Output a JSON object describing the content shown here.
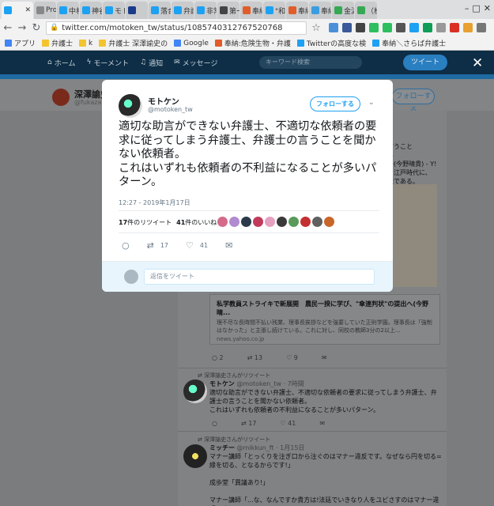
{
  "browser": {
    "tabs": [
      {
        "label": "",
        "color": "#1da1f2"
      },
      {
        "label": "Pro",
        "color": "#888888"
      },
      {
        "label": "中村",
        "color": "#1da1f2"
      },
      {
        "label": "神谷",
        "color": "#1da1f2"
      },
      {
        "label": "モト",
        "color": "#1da1f2"
      },
      {
        "label": "",
        "color": "#1a3a8a"
      },
      {
        "label": "落合",
        "color": "#1da1f2"
      },
      {
        "label": "弁護",
        "color": "#1da1f2"
      },
      {
        "label": "非常",
        "color": "#1da1f2"
      },
      {
        "label": "第一",
        "color": "#444444"
      },
      {
        "label": "奉納",
        "color": "#e25c2a"
      },
      {
        "label": "\"和",
        "color": "#1da1f2"
      },
      {
        "label": "奉納",
        "color": "#e25c2a"
      },
      {
        "label": "奉納",
        "color": "#3b9de0"
      },
      {
        "label": "金沢",
        "color": "#34a853"
      },
      {
        "label": "（株",
        "color": "#34a853"
      }
    ],
    "url": "twitter.com/motoken_tw/status/1085740312767520768",
    "bookmarks": [
      {
        "label": "アプリ",
        "color": "#4285f4"
      },
      {
        "label": "弁護士",
        "color": "#f4c430"
      },
      {
        "label": "k",
        "color": "#f4c430"
      },
      {
        "label": "弁護士 深澤諭史の",
        "color": "#f4c430"
      },
      {
        "label": "Google",
        "color": "#4285f4"
      },
      {
        "label": "奉納:危険生物・弁護",
        "color": "#e25c2a"
      },
      {
        "label": "Twitterの高度な検",
        "color": "#1da1f2"
      },
      {
        "label": "奉納＼さらば弁護士",
        "color": "#1da1f2"
      }
    ]
  },
  "twitter_nav": {
    "home": "ホーム",
    "moments": "モーメント",
    "notifications": "通知",
    "messages": "メッセージ",
    "search_placeholder": "キーワード検索",
    "tweet_button": "ツイート"
  },
  "profile": {
    "name": "深澤諭史",
    "handle": "@fukazawa",
    "follow_button": "フォローする"
  },
  "modal": {
    "author_name": "モトケン",
    "author_handle": "@motoken_tw",
    "follow_button": "フォローする",
    "text": "適切な助言ができない弁護士、不適切な依頼者の要求に従ってしまう弁護士、弁護士の言うことを聞かない依頼者。\nこれはいずれも依頼者の不利益になることが多いパターン。",
    "timestamp": "12:27 - 2019年1月17日",
    "retweet_count": "17",
    "retweet_label": "件のリツイート",
    "like_count": "41",
    "like_label": "件のいいね",
    "action_retweets": "17",
    "action_likes": "41",
    "reply_placeholder": "返信をツイート",
    "liker_colors": [
      "#d46a8a",
      "#b08bd0",
      "#2b3a4a",
      "#c23a5a",
      "#e6a0c0",
      "#3a3a3a",
      "#5a9a5a",
      "#c43030",
      "#606060",
      "#c8662a"
    ]
  },
  "background": {
    "right_snippet": "の言うこと\n多い\nるの(今野晴貴) - Y!\nは、江戸時代に、\n方法である。",
    "card": {
      "title": "私学教員ストライキで新展開　農民一揆に学び、\"傘連判状\"の提出へ(今野晴...",
      "desc": "理不尽な長時間不払い残業、理事長挨拶などを強要していた正則学園。理事長は「強制はなかった」と主張し続けている。これに対し、同校の教師3分の2以上...",
      "url": "news.yahoo.co.jp",
      "replies": "2",
      "retweets": "13",
      "likes": "9"
    },
    "tweet1": {
      "rt_by": "深澤諭史さんがリツイート",
      "name": "モトケン",
      "handle": "@motoken_tw · 7時間",
      "text": "適切な助言ができない弁護士、不適切な依頼者の要求に従ってしまう弁護士、弁護士の言うことを聞かない依頼者。\nこれはいずれも依頼者の不利益になることが多いパターン。",
      "retweets": "17",
      "likes": "41"
    },
    "tweet2": {
      "rt_by": "深澤諭史さんがリツイート",
      "name": "ミッチー",
      "handle": "@mikkun_ft · 1月15日",
      "text": "マナー講師「とっくりを注ぎ口から注ぐのはマナー違反です。なぜなら円を切る=縁を切る、となるからです!」\n\n成歩堂「異議あり!」\n\nマナー講師「...な、なんですか貴方は!法廷でいきなり人をユビさすのはマナー違反です"
    }
  }
}
